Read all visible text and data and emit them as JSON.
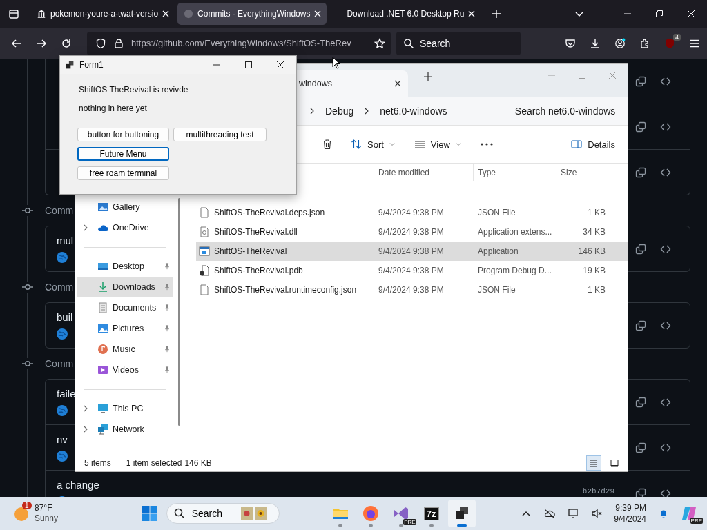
{
  "browser": {
    "tabs": [
      {
        "title": "pokemon-youre-a-twat-versio",
        "selected": false,
        "kind": "repo"
      },
      {
        "title": "Commits - EverythingWindows",
        "selected": true,
        "kind": "github"
      },
      {
        "title": "Download .NET 6.0 Desktop Ru",
        "selected": false,
        "kind": "blank"
      }
    ],
    "url": "https://github.com/EverythingWindows/ShiftOS-TheRev",
    "search": {
      "placeholder": "Search"
    },
    "extension_badge": "4"
  },
  "commits": {
    "groups": [
      {
        "rows": [
          {
            "kind": "commit"
          },
          {
            "kind": "commit"
          },
          {
            "kind": "commit"
          }
        ]
      },
      {
        "heading": "Comm",
        "rows": [
          {
            "kind": "commit",
            "title": "mul"
          }
        ]
      },
      {
        "heading": "Comm",
        "rows": [
          {
            "kind": "commit",
            "title": "buil"
          }
        ]
      },
      {
        "heading": "Comm",
        "rows": [
          {
            "kind": "commit",
            "title": "faile"
          },
          {
            "kind": "commit",
            "title": "nv"
          },
          {
            "kind": "commit",
            "title": "a change",
            "sha": "b2b7d29"
          }
        ]
      }
    ]
  },
  "form1": {
    "title": "Form1",
    "labels": [
      "ShiftOS TheRevival is revivde",
      "nothing in here yet"
    ],
    "button_rows": [
      [
        {
          "label": "button for buttoning",
          "focused": false
        },
        {
          "label": "multithreading test",
          "focused": false
        }
      ],
      [
        {
          "label": "Future Menu",
          "focused": true
        }
      ],
      [
        {
          "label": "free roam terminal",
          "focused": false
        }
      ]
    ]
  },
  "explorer": {
    "tab": {
      "title": "windows"
    },
    "breadcrumb": [
      "Debug",
      "net6.0-windows"
    ],
    "search": {
      "placeholder": "Search net6.0-windows"
    },
    "toolbar": [
      {
        "kind": "delete"
      },
      {
        "kind": "sort",
        "label": "Sort"
      },
      {
        "kind": "view",
        "label": "View"
      },
      {
        "kind": "more"
      }
    ],
    "details_label": "Details",
    "columns": [
      "Date modified",
      "Type",
      "Size"
    ],
    "sidebar": [
      [
        {
          "label": "Gallery",
          "kind": "gallery",
          "pinned": false,
          "expandable": false,
          "selected": false
        },
        {
          "label": "OneDrive",
          "kind": "onedrive",
          "pinned": false,
          "expandable": true,
          "selected": false
        }
      ],
      [
        {
          "label": "Desktop",
          "kind": "desktop",
          "pinned": true,
          "expandable": false,
          "selected": false
        },
        {
          "label": "Downloads",
          "kind": "downloads",
          "pinned": true,
          "expandable": false,
          "selected": true
        },
        {
          "label": "Documents",
          "kind": "documents",
          "pinned": true,
          "expandable": false,
          "selected": false
        },
        {
          "label": "Pictures",
          "kind": "pictures",
          "pinned": true,
          "expandable": false,
          "selected": false
        },
        {
          "label": "Music",
          "kind": "music",
          "pinned": true,
          "expandable": false,
          "selected": false
        },
        {
          "label": "Videos",
          "kind": "videos",
          "pinned": true,
          "expandable": false,
          "selected": false
        }
      ],
      [
        {
          "label": "This PC",
          "kind": "pc",
          "pinned": false,
          "expandable": true,
          "selected": false
        },
        {
          "label": "Network",
          "kind": "network",
          "pinned": false,
          "expandable": true,
          "selected": false
        }
      ]
    ],
    "files": [
      {
        "name": "ShiftOS-TheRevival.deps.json",
        "date": "9/4/2024 9:38 PM",
        "type": "JSON File",
        "size": "1 KB",
        "kind": "file",
        "selected": false
      },
      {
        "name": "ShiftOS-TheRevival.dll",
        "date": "9/4/2024 9:38 PM",
        "type": "Application extens...",
        "size": "34 KB",
        "kind": "dll",
        "selected": false
      },
      {
        "name": "ShiftOS-TheRevival",
        "date": "9/4/2024 9:38 PM",
        "type": "Application",
        "size": "146 KB",
        "kind": "app",
        "selected": true
      },
      {
        "name": "ShiftOS-TheRevival.pdb",
        "date": "9/4/2024 9:38 PM",
        "type": "Program Debug D...",
        "size": "19 KB",
        "kind": "pdb",
        "selected": false
      },
      {
        "name": "ShiftOS-TheRevival.runtimeconfig.json",
        "date": "9/4/2024 9:38 PM",
        "type": "JSON File",
        "size": "1 KB",
        "kind": "file",
        "selected": false
      }
    ],
    "status": {
      "count": "5 items",
      "selection": "1 item selected",
      "size": "146 KB"
    },
    "view_buttons": [
      {
        "kind": "details",
        "selected": true
      },
      {
        "kind": "tiles",
        "selected": false
      }
    ]
  },
  "taskbar": {
    "weather": {
      "badge": "1",
      "temperature": "87°F",
      "condition": "Sunny"
    },
    "search": {
      "placeholder": "Search"
    },
    "apps": [
      {
        "kind": "files",
        "active": false
      },
      {
        "kind": "firefox",
        "active": false
      },
      {
        "kind": "visual-studio",
        "badge": "PRE",
        "active": false
      },
      {
        "kind": "archiver",
        "label": "7z",
        "active": false
      },
      {
        "kind": "app",
        "active": true
      }
    ],
    "clock": {
      "time": "9:39 PM",
      "date": "9/4/2024"
    },
    "copilot_badge": "PRE"
  }
}
